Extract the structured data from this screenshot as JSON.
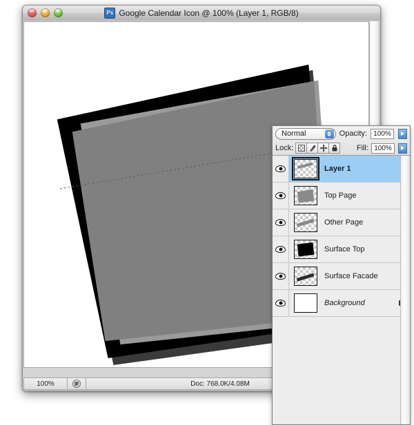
{
  "window": {
    "title": "Google Calendar Icon @ 100% (Layer 1, RGB/8)",
    "app_icon": "photoshop-icon",
    "app_icon_text": "Ps",
    "traffic_lights": [
      {
        "name": "close",
        "color": "#ec5f55"
      },
      {
        "name": "minimize",
        "color": "#f2ac34"
      },
      {
        "name": "zoom",
        "color": "#71c544"
      }
    ]
  },
  "statusbar": {
    "zoom": "100%",
    "page_icon": "document-sizes-icon",
    "doc_info": "Doc: 768.0K/4.08M",
    "menu_arrow": "triangle-right-icon"
  },
  "layers_panel": {
    "blend_mode": "Normal",
    "opacity_label": "Opacity:",
    "opacity_value": "100%",
    "fill_label": "Fill:",
    "fill_value": "100%",
    "lock_label": "Lock:",
    "lock_buttons": [
      {
        "name": "lock-transparent-pixels-icon"
      },
      {
        "name": "lock-image-pixels-icon",
        "glyph": "✎"
      },
      {
        "name": "lock-position-icon",
        "glyph": "✥"
      },
      {
        "name": "lock-all-icon",
        "glyph": "ὑ2"
      }
    ],
    "layers": [
      {
        "name": "Layer 1",
        "selected": true,
        "visible": true,
        "locked": false,
        "italic": false,
        "thumb": "transparent-diagonal"
      },
      {
        "name": "Top Page",
        "selected": false,
        "visible": true,
        "locked": false,
        "italic": false,
        "thumb": "transparent-gray-quad"
      },
      {
        "name": "Other Page",
        "selected": false,
        "visible": true,
        "locked": false,
        "italic": false,
        "thumb": "transparent-thin-band"
      },
      {
        "name": "Surface Top",
        "selected": false,
        "visible": true,
        "locked": false,
        "italic": false,
        "thumb": "transparent-black-quad"
      },
      {
        "name": "Surface Facade",
        "selected": false,
        "visible": true,
        "locked": false,
        "italic": false,
        "thumb": "transparent-dark-band"
      },
      {
        "name": "Background",
        "selected": false,
        "visible": true,
        "locked": true,
        "italic": true,
        "thumb": "white-solid"
      }
    ]
  },
  "colors": {
    "selection_blue": "#9ccdf5",
    "panel_bg": "#ededed",
    "canvas_bg": "#ffffff",
    "art_gray": "#808080",
    "art_light_gray": "#999999",
    "art_black": "#000000",
    "art_dark_gray": "#3a3a3a"
  }
}
